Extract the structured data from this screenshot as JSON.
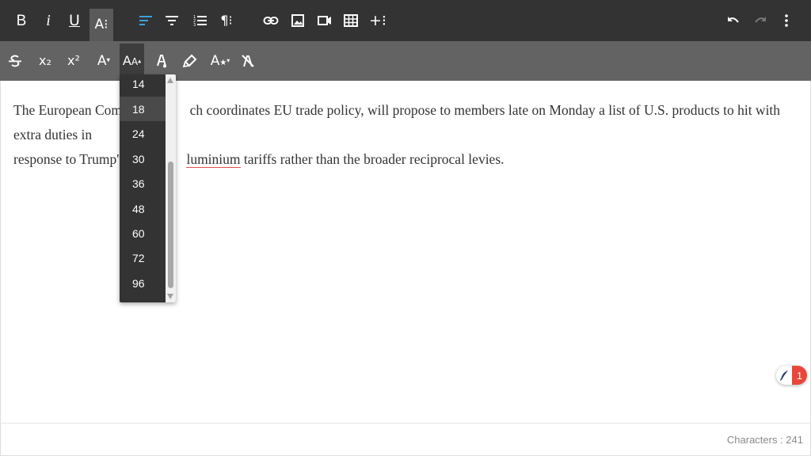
{
  "toolbar_primary": {
    "buttons": [
      {
        "name": "bold-button",
        "icon": "bold-icon",
        "glyph": "B"
      },
      {
        "name": "italic-button",
        "icon": "italic-icon",
        "glyph": "i"
      },
      {
        "name": "underline-button",
        "icon": "underline-icon",
        "glyph": "U"
      },
      {
        "name": "more-text-button",
        "icon": "text-format-more-icon",
        "glyph": "A⁝",
        "state": "active"
      },
      {
        "name": "align-left-button",
        "icon": "align-left-icon",
        "state": "selected-blue"
      },
      {
        "name": "text-align-button",
        "icon": "filter-lines-icon"
      },
      {
        "name": "ordered-list-button",
        "icon": "ordered-list-icon"
      },
      {
        "name": "more-paragraph-button",
        "icon": "paragraph-icon",
        "glyph": "¶⁝"
      },
      {
        "name": "insert-link-button",
        "icon": "link-icon"
      },
      {
        "name": "insert-image-button",
        "icon": "image-icon"
      },
      {
        "name": "insert-video-button",
        "icon": "video-icon"
      },
      {
        "name": "insert-table-button",
        "icon": "table-icon"
      },
      {
        "name": "more-insert-button",
        "icon": "plus-more-icon",
        "glyph": "+⁝"
      },
      {
        "name": "undo-button",
        "icon": "undo-icon"
      },
      {
        "name": "redo-button",
        "icon": "redo-icon",
        "state": "disabled"
      },
      {
        "name": "more-misc-button",
        "icon": "vertical-dots-icon"
      }
    ]
  },
  "toolbar_secondary": {
    "buttons": [
      {
        "name": "strikethrough-button",
        "icon": "strikethrough-icon"
      },
      {
        "name": "subscript-button",
        "icon": "subscript-icon",
        "glyph": "x₂"
      },
      {
        "name": "superscript-button",
        "icon": "superscript-icon",
        "glyph": "x²"
      },
      {
        "name": "font-family-button",
        "icon": "font-family-dropdown-icon",
        "glyph": "A"
      },
      {
        "name": "font-size-button",
        "icon": "font-size-dropdown-icon",
        "glyph": "AA",
        "state": "selected"
      },
      {
        "name": "text-color-button",
        "icon": "text-color-icon"
      },
      {
        "name": "background-color-button",
        "icon": "highlighter-icon"
      },
      {
        "name": "inline-style-button",
        "icon": "inline-style-icon"
      },
      {
        "name": "clear-formatting-button",
        "icon": "clear-formatting-icon"
      }
    ]
  },
  "font_size_dropdown": {
    "items": [
      "14",
      "18",
      "24",
      "30",
      "36",
      "48",
      "60",
      "72",
      "96"
    ],
    "hovered": "18"
  },
  "editor": {
    "line1_a": "The European Comm",
    "line1_b": "ch coordinates EU trade policy, will propose to members late on Monday a list of U.S. products to hit with extra duties in",
    "line2_a": "response to Trump's s",
    "line2_misspelled": "luminium",
    "line2_b": " tariffs rather than the broader reciprocal levies."
  },
  "footer": {
    "char_count": "Characters : 241"
  },
  "badge": {
    "count": "1",
    "icon": "feather-pen-icon"
  },
  "colors": {
    "toolbar_primary_bg": "#333333",
    "toolbar_secondary_bg": "#636363",
    "accent_blue": "#3ca0dc",
    "badge_red": "#e8473b"
  }
}
